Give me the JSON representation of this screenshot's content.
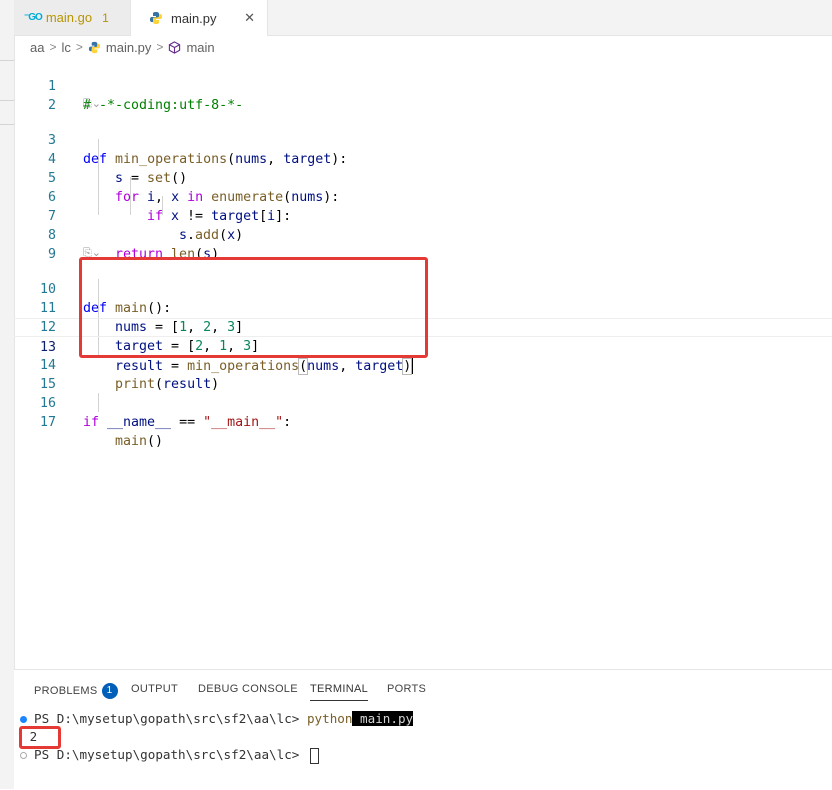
{
  "tabs": [
    {
      "icon": "go-icon",
      "label": "main.go",
      "count": "1"
    },
    {
      "icon": "python-icon",
      "label": "main.py",
      "close": "✕"
    }
  ],
  "breadcrumb": {
    "items": [
      "aa",
      "lc",
      "main.py",
      "main"
    ],
    "separator": ">"
  },
  "editor": {
    "lines": {
      "l1": "1",
      "l2": "2",
      "l3": "3",
      "l4": "4",
      "l5": "5",
      "l6": "6",
      "l7": "7",
      "l8": "8",
      "l9": "9",
      "l10": "10",
      "l11": "11",
      "l12": "12",
      "l13": "13",
      "l14": "14",
      "l15": "15",
      "l16": "16",
      "l17": "17"
    },
    "code": {
      "c1": "# -*-coding:utf-8-*-",
      "c3_def": "def",
      "c3_fn": "min_operations",
      "c3_rest_a": "(",
      "c3_p1": "nums",
      "c3_rest_b": ", ",
      "c3_p2": "target",
      "c3_rest_c": "):",
      "c4_var": "s",
      "c4_eq": " = ",
      "c4_fn": "set",
      "c4_end": "()",
      "c5_for": "for",
      "c5_i": " i",
      "c5_comma": ", ",
      "c5_x": "x",
      "c5_in": " in ",
      "c5_fn": "enumerate",
      "c5_a": "(",
      "c5_nums": "nums",
      "c5_b": "):",
      "c6_if": "if",
      "c6_x": " x",
      "c6_ne": " != ",
      "c6_t": "target",
      "c6_idx": "[",
      "c6_i": "i",
      "c6_end": "]:",
      "c7_s": "s",
      "c7_dot": ".",
      "c7_add": "add",
      "c7_a": "(",
      "c7_x": "x",
      "c7_b": ")",
      "c8_ret": "return",
      "c8_fn": " len",
      "c8_a": "(",
      "c8_s": "s",
      "c8_b": ")",
      "c10_def": "def",
      "c10_fn": " main",
      "c10_end": "():",
      "c11_v": "nums",
      "c11_eq": " = [",
      "c11_n1": "1",
      "c11_c1": ", ",
      "c11_n2": "2",
      "c11_c2": ", ",
      "c11_n3": "3",
      "c11_end": "]",
      "c12_v": "target",
      "c12_eq": " = [",
      "c12_n1": "2",
      "c12_c1": ", ",
      "c12_n2": "1",
      "c12_c2": ", ",
      "c12_n3": "3",
      "c12_end": "]",
      "c13_v": "result",
      "c13_eq": " = ",
      "c13_fn": "min_operations",
      "c13_a": "(",
      "c13_p1": "nums",
      "c13_c": ", ",
      "c13_p2": "target",
      "c13_b": ")",
      "c14_fn": "print",
      "c14_a": "(",
      "c14_v": "result",
      "c14_b": ")",
      "c16_if": "if",
      "c16_name": " __name__",
      "c16_eq": " == ",
      "c16_str": "\"__main__\"",
      "c16_colon": ":",
      "c17_fn": "main",
      "c17_end": "()"
    },
    "codelens": "⎘⌄"
  },
  "panel": {
    "tabs": [
      "PROBLEMS",
      "OUTPUT",
      "DEBUG CONSOLE",
      "TERMINAL",
      "PORTS"
    ],
    "problems_count": "1",
    "active_tab": "TERMINAL",
    "terminal": {
      "prompt1": "PS D:\\mysetup\\gopath\\src\\sf2\\aa\\lc> ",
      "cmd": "python",
      "arg": " main.py",
      "output": "2",
      "prompt2": "PS D:\\mysetup\\gopath\\src\\sf2\\aa\\lc> "
    }
  },
  "colors": {
    "highlight": "#e53935",
    "badge": "#005fb8",
    "keyword": "#0000ff",
    "function": "#795e26",
    "variable": "#001080",
    "number": "#098658",
    "comment": "#008000",
    "string": "#a31515"
  }
}
